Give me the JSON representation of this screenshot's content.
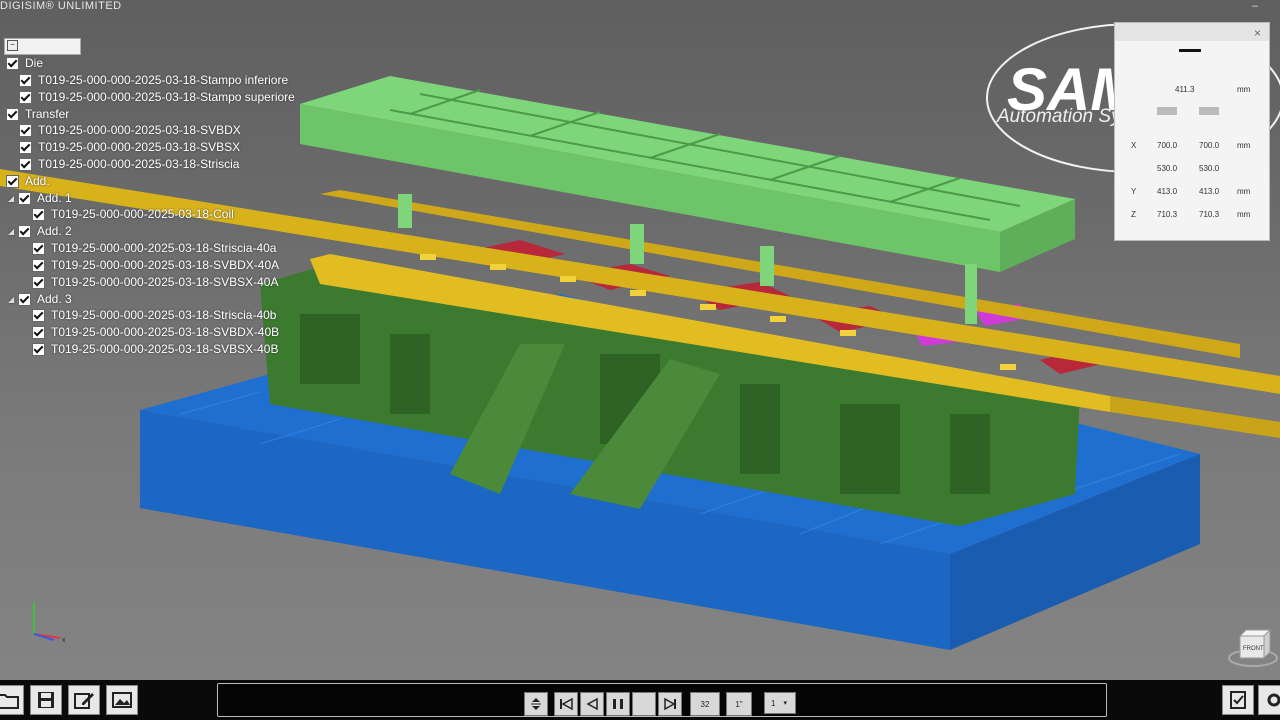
{
  "app": {
    "title": "DIGISIM® UNLIMITED",
    "minimize": "–"
  },
  "tree": {
    "search_icon": "−",
    "groups": [
      {
        "label": "Die",
        "items": [
          "T019-25-000-000-2025-03-18-Stampo inferiore",
          "T019-25-000-000-2025-03-18-Stampo superiore"
        ]
      },
      {
        "label": "Transfer",
        "items": [
          "T019-25-000-000-2025-03-18-SVBDX",
          "T019-25-000-000-2025-03-18-SVBSX",
          "T019-25-000-000-2025-03-18-Striscia"
        ]
      },
      {
        "label": "Add.",
        "subgroups": [
          {
            "label": "Add. 1",
            "items": [
              "T019-25-000-000-2025-03-18-Coil"
            ]
          },
          {
            "label": "Add. 2",
            "items": [
              "T019-25-000-000-2025-03-18-Striscia-40a",
              "T019-25-000-000-2025-03-18-SVBDX-40A",
              "T019-25-000-000-2025-03-18-SVBSX-40A"
            ]
          },
          {
            "label": "Add. 3",
            "items": [
              "T019-25-000-000-2025-03-18-Striscia-40b",
              "T019-25-000-000-2025-03-18-SVBDX-40B",
              "T019-25-000-000-2025-03-18-SVBSX-40B"
            ]
          }
        ]
      }
    ]
  },
  "logo": {
    "brand": "SAMEC",
    "tagline": "Automation Systems"
  },
  "measure_panel": {
    "close": "×",
    "rows": [
      {
        "axis": "",
        "a": "411.3",
        "b": "",
        "unit": "mm"
      },
      {
        "axis": "X",
        "a": "700.0",
        "b": "700.0",
        "unit": "mm"
      },
      {
        "axis": "",
        "a": "530.0",
        "b": "530.0",
        "unit": ""
      },
      {
        "axis": "Y",
        "a": "413.0",
        "b": "413.0",
        "unit": "mm"
      },
      {
        "axis": "Z",
        "a": "710.3",
        "b": "710.3",
        "unit": "mm"
      }
    ]
  },
  "playback": {
    "frame": "32",
    "speed": "1\"",
    "step": "1"
  },
  "cube_label": "FRONT",
  "colors": {
    "base": "#1f6fd0",
    "die": "#3c7a2f",
    "die_upper": "#7fd67a",
    "transfer": "#d8b21a",
    "strip": "#b8283b",
    "part": "#d03bd8"
  }
}
